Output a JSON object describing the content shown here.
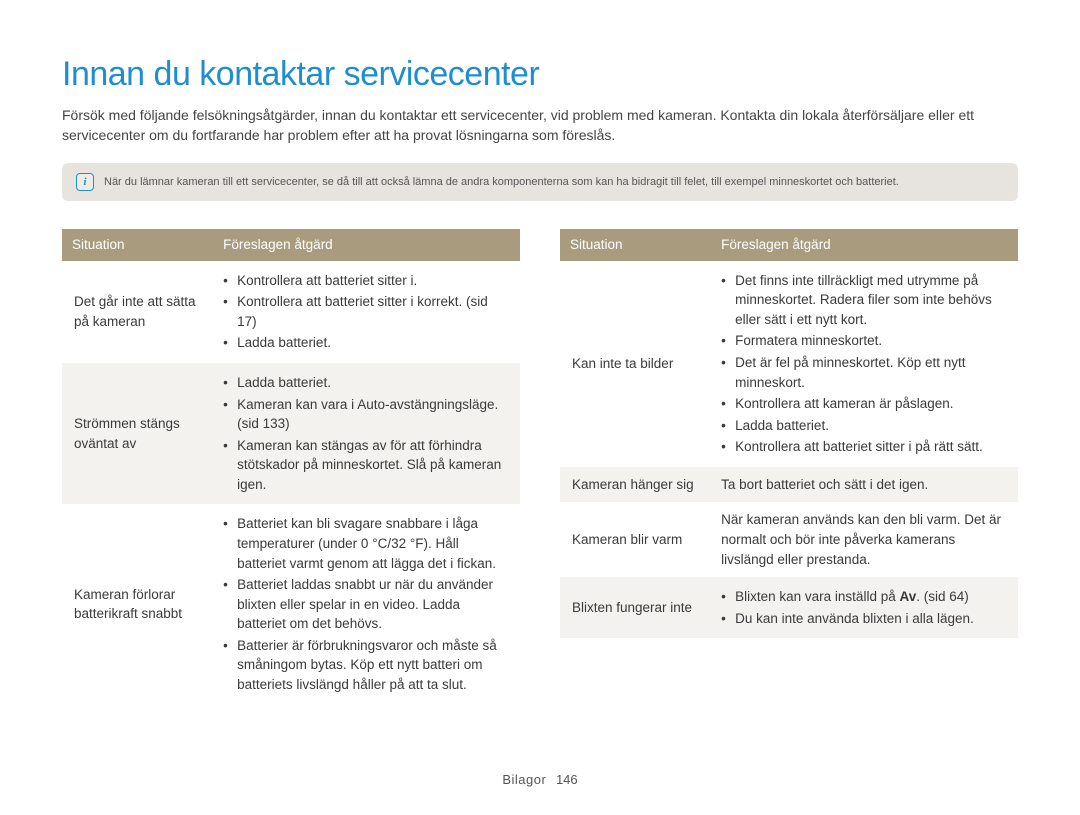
{
  "title": "Innan du kontaktar servicecenter",
  "intro": "Försök med följande felsökningsåtgärder, innan du kontaktar ett servicecenter, vid problem med kameran. Kontakta din lokala återförsäljare eller ett servicecenter om du fortfarande har problem efter att ha provat lösningarna som föreslås.",
  "note": "När du lämnar kameran till ett servicecenter, se då till att också lämna de andra komponenterna som kan ha bidragit till felet, till exempel minneskortet och batteriet.",
  "headers": {
    "situation": "Situation",
    "action": "Föreslagen åtgärd"
  },
  "left": [
    {
      "situation": "Det går inte att sätta på kameran",
      "actions": [
        "Kontrollera att batteriet sitter i.",
        "Kontrollera att batteriet sitter i korrekt. (sid 17)",
        "Ladda batteriet."
      ]
    },
    {
      "situation": "Strömmen stängs oväntat av",
      "actions": [
        "Ladda batteriet.",
        "Kameran kan vara i Auto-avstängningsläge. (sid 133)",
        "Kameran kan stängas av för att förhindra stötskador på minneskortet. Slå på kameran igen."
      ]
    },
    {
      "situation": "Kameran förlorar batterikraft snabbt",
      "actions": [
        "Batteriet kan bli svagare snabbare i låga temperaturer (under 0 °C/32 °F). Håll batteriet varmt genom att lägga det i fickan.",
        "Batteriet laddas snabbt ur när du använder blixten eller spelar in en video. Ladda batteriet om det behövs.",
        "Batterier är förbrukningsvaror och måste så småningom bytas. Köp ett nytt batteri om batteriets livslängd håller på att ta slut."
      ]
    }
  ],
  "right": [
    {
      "situation": "Kan inte ta bilder",
      "actions": [
        "Det finns inte tillräckligt med utrymme på minneskortet. Radera filer som inte behövs eller sätt i ett nytt kort.",
        "Formatera minneskortet.",
        "Det är fel på minneskortet. Köp ett nytt minneskort.",
        "Kontrollera att kameran är påslagen.",
        "Ladda batteriet.",
        "Kontrollera att batteriet sitter i på rätt sätt."
      ]
    },
    {
      "situation": "Kameran hänger sig",
      "plain": "Ta bort batteriet och sätt i det igen."
    },
    {
      "situation": "Kameran blir varm",
      "plain": "När kameran används kan den bli varm. Det är normalt och bör inte påverka kamerans livslängd eller prestanda."
    },
    {
      "situation": "Blixten fungerar inte",
      "actions_html": [
        "Blixten kan vara inställd på <span class=\"strong-in\">Av</span>. (sid 64)",
        "Du kan inte använda blixten i alla lägen."
      ]
    }
  ],
  "footer": {
    "label": "Bilagor",
    "page": "146"
  }
}
